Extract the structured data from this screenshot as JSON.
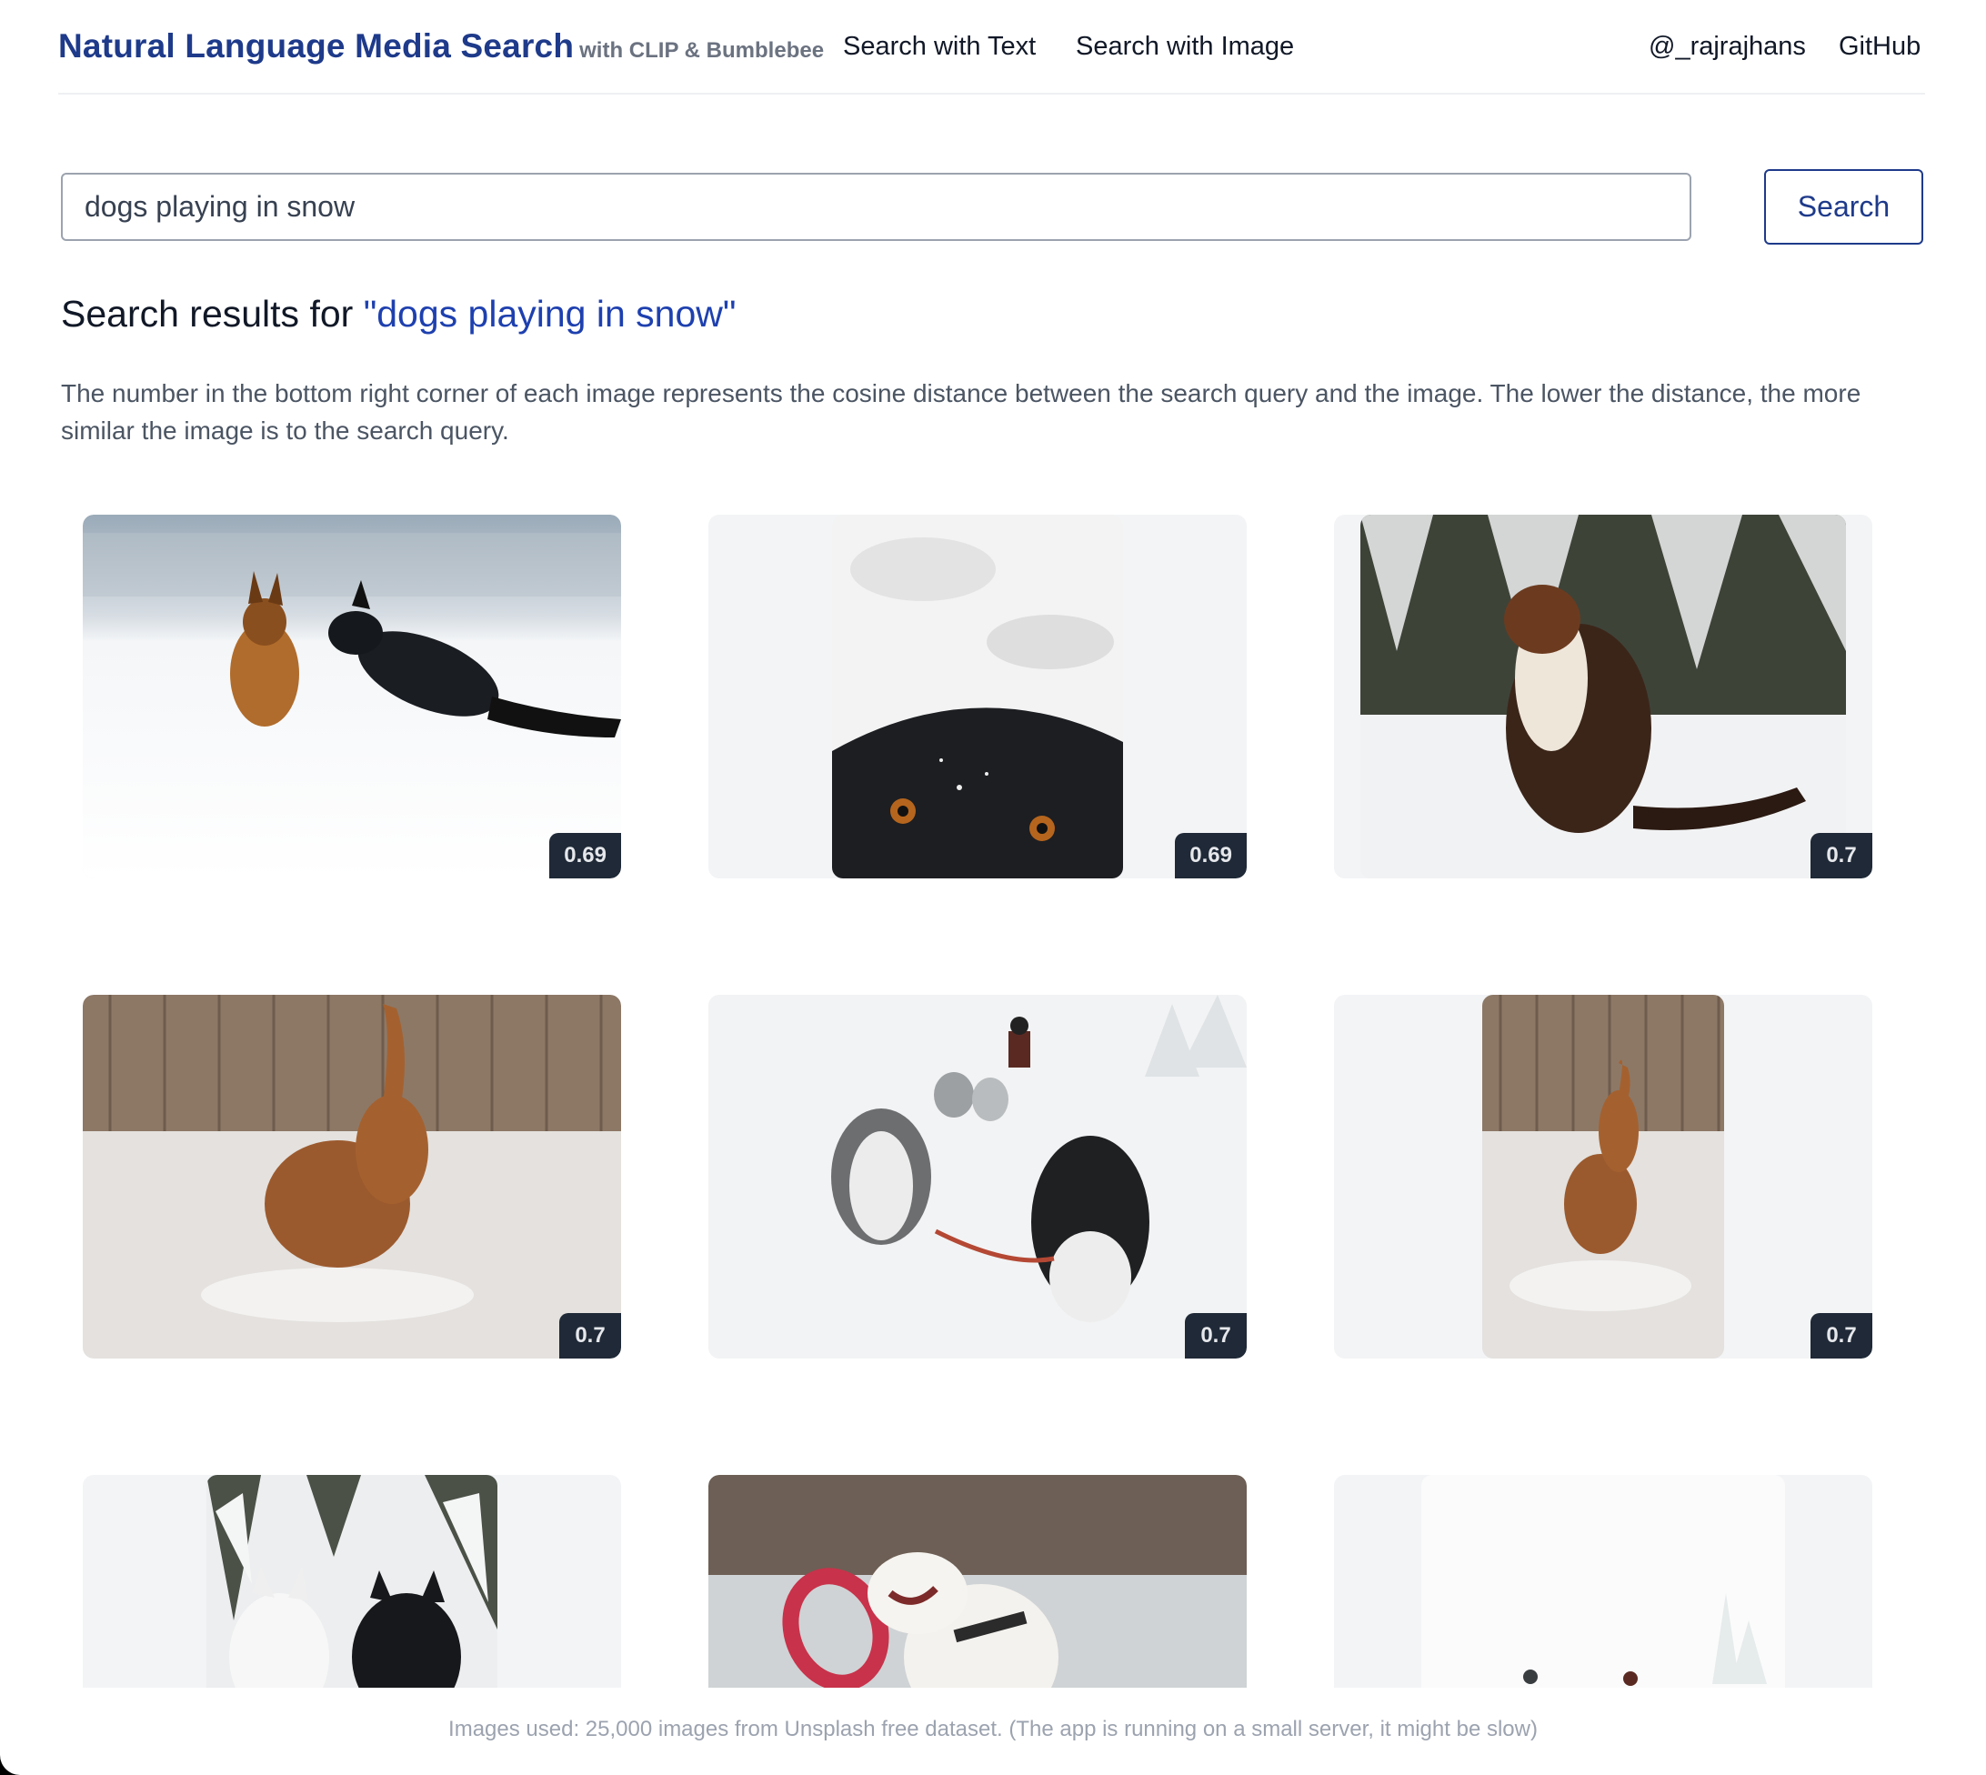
{
  "header": {
    "title": "Natural Language Media Search",
    "subtitle": "with CLIP & Bumblebee",
    "nav": {
      "text": "Search with Text",
      "image": "Search with Image"
    },
    "links": {
      "author": "@_rajrajhans",
      "github": "GitHub"
    }
  },
  "search": {
    "value": "dogs playing in snow",
    "button_label": "Search"
  },
  "results": {
    "heading_prefix": "Search results for ",
    "heading_query": "\"dogs playing in snow\"",
    "explanation": "The number in the bottom right corner of each image represents the cosine distance between the search query and the image. The lower the distance, the more similar the image is to the search query.",
    "items": [
      {
        "subject": "two dogs running in snow",
        "score": "0.69"
      },
      {
        "subject": "close-up of dog face with snow",
        "score": "0.69"
      },
      {
        "subject": "collie sitting in snowy forest",
        "score": "0.7"
      },
      {
        "subject": "doodle dog digging in snow by fence",
        "score": "0.7"
      },
      {
        "subject": "husky sled team",
        "score": "0.7"
      },
      {
        "subject": "doodle dog in snow, portrait crop",
        "score": "0.7"
      },
      {
        "subject": "white husky and black dog in snowy trees",
        "score": ""
      },
      {
        "subject": "white dog catching red ring",
        "score": ""
      },
      {
        "subject": "snowy field with tiny figures",
        "score": ""
      }
    ]
  },
  "footer": {
    "note": "Images used: 25,000 images from Unsplash free dataset. (The app is running on a small server, it might be slow)"
  },
  "colors": {
    "brand": "#1e3a8a",
    "query_accent": "#1e40af",
    "badge_bg": "#1f2937",
    "cell_bg": "#f3f4f6"
  }
}
